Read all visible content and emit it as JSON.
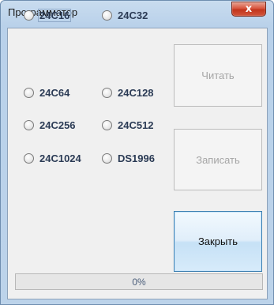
{
  "window": {
    "title": "Программатор",
    "close_glyph": "x"
  },
  "chips": [
    {
      "label": "24C16",
      "focused": true
    },
    {
      "label": "24C32"
    },
    {
      "label": "24C64"
    },
    {
      "label": "24C128"
    },
    {
      "label": "24C256"
    },
    {
      "label": "24C512"
    },
    {
      "label": "24C1024"
    },
    {
      "label": "DS1996"
    }
  ],
  "buttons": {
    "read": "Читать",
    "write": "Записать",
    "close": "Закрыть"
  },
  "progress": {
    "value": 0,
    "text": "0%"
  },
  "colors": {
    "accent": "#3c7fb1",
    "disabled_text": "#a5a5a5"
  }
}
